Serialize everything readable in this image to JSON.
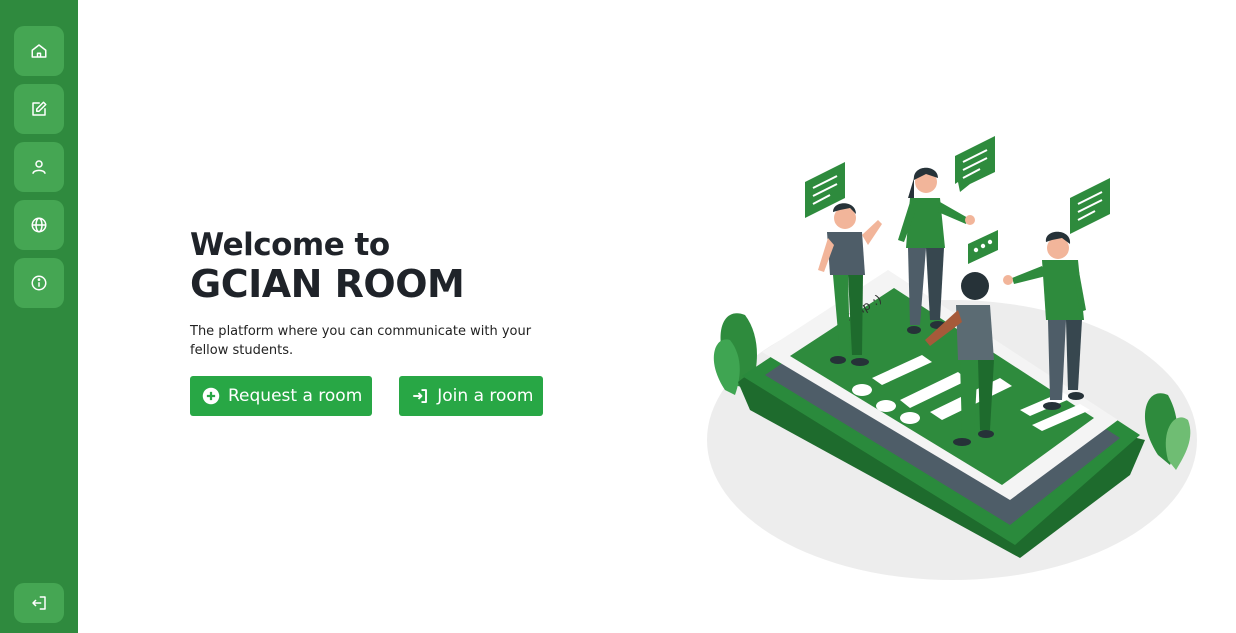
{
  "sidebar": {
    "items": [
      {
        "name": "home",
        "icon": "home-icon"
      },
      {
        "name": "edit",
        "icon": "edit-icon"
      },
      {
        "name": "profile",
        "icon": "user-icon"
      },
      {
        "name": "explore",
        "icon": "globe-icon"
      },
      {
        "name": "about",
        "icon": "info-icon"
      }
    ],
    "logout": {
      "icon": "logout-icon"
    }
  },
  "hero": {
    "welcome": "Welcome to",
    "brand": "GCIAN ROOM",
    "tagline": "The platform where you can communicate with your fellow students."
  },
  "actions": {
    "request_label": "Request a room",
    "request_icon": "plus-circle-icon",
    "join_label": "Join a room",
    "join_icon": "sign-in-icon"
  },
  "illustration": {
    "phone_text": "Group :)"
  },
  "colors": {
    "sidebar": "#2f8a3e",
    "nav_button": "#45a653",
    "primary_button": "#28a745",
    "heading": "#1f2329"
  }
}
